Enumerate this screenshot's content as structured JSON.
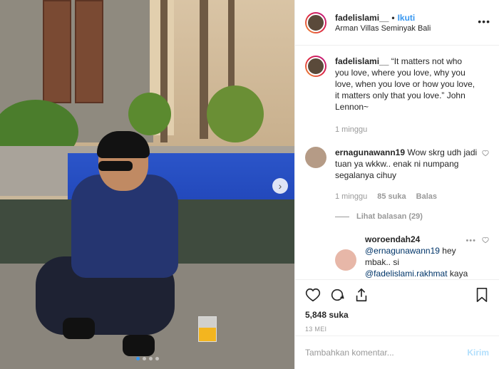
{
  "post": {
    "username": "fadelislami__",
    "separator": "•",
    "follow_label": "Ikuti",
    "location": "Arman Villas Seminyak Bali",
    "more_label": "•••"
  },
  "caption": {
    "username": "fadelislami__",
    "text": "“It matters not who you love, where you love, why you love, when you love or how you love, it matters only that you love.” John Lennon~",
    "time": "1 minggu"
  },
  "comments": [
    {
      "username": "ernagunawann19",
      "text": "Wow skrg udh jadi tuan ya wkkw.. enak ni numpang segalanya cihuy",
      "time": "1 minggu",
      "likes": "85 suka",
      "reply_label": "Balas",
      "view_replies": "Lihat balasan (29)"
    }
  ],
  "reply": {
    "username": "woroendah24",
    "mention1": "@ernagunawann19",
    "text1": " hey mbak.. si",
    "mention2": "@fadelislami.rakhmat",
    "text2": " kaya"
  },
  "stats": {
    "likes": "5,848 suka",
    "date": "13 MEI"
  },
  "composer": {
    "placeholder": "Tambahkan komentar...",
    "send_label": "Kirim"
  },
  "carousel": {
    "next_icon": "chevron-right-icon",
    "slide_count": 4,
    "active_slide": 1
  },
  "colors": {
    "link": "#3897f0",
    "mention": "#003569",
    "muted": "#999999",
    "send_disabled": "#b2dffc"
  }
}
